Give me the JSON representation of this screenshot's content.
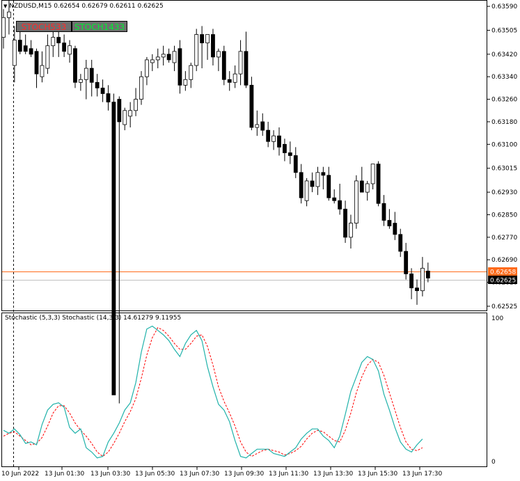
{
  "header": {
    "arrow": "▼",
    "symbol_info": "NZDUSD,M15  0.62654 0.62679 0.62611 0.62625"
  },
  "buttons": [
    {
      "label": "STOCH533",
      "color": "#ff2b2b"
    },
    {
      "label": "STOCH1433",
      "color": "#00ee33"
    }
  ],
  "indicator": {
    "title": "Stochastic (5,3,3)  Stochastic (14,3,3) 14.61279 9.11955",
    "scale_max": "100",
    "scale_min": "0"
  },
  "price_axis": {
    "labels": [
      "0.63590",
      "0.63505",
      "0.63420",
      "0.63340",
      "0.63260",
      "0.63180",
      "0.63100",
      "0.63015",
      "0.62930",
      "0.62850",
      "0.62770",
      "0.62690",
      "0.62610",
      "0.62525"
    ],
    "current_price": {
      "label": "0.62658",
      "color": "#ff6a1a"
    },
    "bid_price": {
      "label": "0.62625",
      "color": "#000000"
    }
  },
  "time_axis": {
    "labels": [
      "10 Jun 2022",
      "13 Jun 01:30",
      "13 Jun 03:30",
      "13 Jun 05:30",
      "13 Jun 07:30",
      "13 Jun 09:30",
      "13 Jun 11:30",
      "13 Jun 13:30",
      "13 Jun 15:30",
      "13 Jun 17:30"
    ]
  },
  "colors": {
    "bull_candle": "#ffffff",
    "bear_candle": "#000000",
    "stoch_main": "#20b2aa",
    "stoch_signal": "#ff0000",
    "price_line_ask": "#ff6a1a",
    "price_line_bid": "#c0c0c0"
  },
  "chart_data": {
    "type": "candlestick",
    "price_ylim": [
      0.6251,
      0.6361
    ],
    "candles": [
      {
        "o": 0.6348,
        "h": 0.6358,
        "l": 0.6344,
        "c": 0.6355
      },
      {
        "o": 0.6355,
        "h": 0.6361,
        "l": 0.6349,
        "c": 0.6357
      },
      {
        "o": 0.6338,
        "h": 0.6352,
        "l": 0.6332,
        "c": 0.6347
      },
      {
        "o": 0.6347,
        "h": 0.6351,
        "l": 0.6342,
        "c": 0.6343
      },
      {
        "o": 0.6345,
        "h": 0.6349,
        "l": 0.6342,
        "c": 0.6343
      },
      {
        "o": 0.6344,
        "h": 0.6347,
        "l": 0.6341,
        "c": 0.6342
      },
      {
        "o": 0.6343,
        "h": 0.6344,
        "l": 0.633,
        "c": 0.6335
      },
      {
        "o": 0.6334,
        "h": 0.6343,
        "l": 0.6332,
        "c": 0.6338
      },
      {
        "o": 0.6337,
        "h": 0.6349,
        "l": 0.6335,
        "c": 0.6345
      },
      {
        "o": 0.6345,
        "h": 0.6351,
        "l": 0.6341,
        "c": 0.6348
      },
      {
        "o": 0.6348,
        "h": 0.6351,
        "l": 0.6341,
        "c": 0.6346
      },
      {
        "o": 0.6346,
        "h": 0.6349,
        "l": 0.6341,
        "c": 0.6343
      },
      {
        "o": 0.6342,
        "h": 0.6347,
        "l": 0.6339,
        "c": 0.6345
      },
      {
        "o": 0.6344,
        "h": 0.6345,
        "l": 0.633,
        "c": 0.6332
      },
      {
        "o": 0.6332,
        "h": 0.6335,
        "l": 0.6329,
        "c": 0.6333
      },
      {
        "o": 0.6333,
        "h": 0.634,
        "l": 0.6326,
        "c": 0.6337
      },
      {
        "o": 0.6337,
        "h": 0.634,
        "l": 0.6327,
        "c": 0.6332
      },
      {
        "o": 0.6332,
        "h": 0.6335,
        "l": 0.6327,
        "c": 0.633
      },
      {
        "o": 0.633,
        "h": 0.6333,
        "l": 0.6325,
        "c": 0.6328
      },
      {
        "o": 0.6328,
        "h": 0.6331,
        "l": 0.6322,
        "c": 0.6325
      },
      {
        "o": 0.6325,
        "h": 0.6328,
        "l": 0.6221,
        "c": 0.6221
      },
      {
        "o": 0.6326,
        "h": 0.6327,
        "l": 0.6218,
        "c": 0.6318
      },
      {
        "o": 0.6317,
        "h": 0.6323,
        "l": 0.6315,
        "c": 0.6322
      },
      {
        "o": 0.632,
        "h": 0.6325,
        "l": 0.6316,
        "c": 0.6322
      },
      {
        "o": 0.6322,
        "h": 0.633,
        "l": 0.632,
        "c": 0.6326
      },
      {
        "o": 0.6326,
        "h": 0.6336,
        "l": 0.6324,
        "c": 0.6334
      },
      {
        "o": 0.6334,
        "h": 0.6341,
        "l": 0.6331,
        "c": 0.634
      },
      {
        "o": 0.6339,
        "h": 0.6342,
        "l": 0.6336,
        "c": 0.634
      },
      {
        "o": 0.634,
        "h": 0.6344,
        "l": 0.6337,
        "c": 0.6341
      },
      {
        "o": 0.6341,
        "h": 0.6345,
        "l": 0.6338,
        "c": 0.6342
      },
      {
        "o": 0.6342,
        "h": 0.6344,
        "l": 0.6339,
        "c": 0.634
      },
      {
        "o": 0.6339,
        "h": 0.6345,
        "l": 0.6336,
        "c": 0.6343
      },
      {
        "o": 0.6344,
        "h": 0.6347,
        "l": 0.6328,
        "c": 0.6331
      },
      {
        "o": 0.6331,
        "h": 0.6336,
        "l": 0.6329,
        "c": 0.6333
      },
      {
        "o": 0.6333,
        "h": 0.6339,
        "l": 0.633,
        "c": 0.6338
      },
      {
        "o": 0.6338,
        "h": 0.6351,
        "l": 0.6336,
        "c": 0.6349
      },
      {
        "o": 0.6349,
        "h": 0.6352,
        "l": 0.6337,
        "c": 0.6346
      },
      {
        "o": 0.6346,
        "h": 0.6349,
        "l": 0.634,
        "c": 0.6349
      },
      {
        "o": 0.6349,
        "h": 0.6351,
        "l": 0.6338,
        "c": 0.6341
      },
      {
        "o": 0.6341,
        "h": 0.6344,
        "l": 0.6336,
        "c": 0.6343
      },
      {
        "o": 0.6343,
        "h": 0.6345,
        "l": 0.6331,
        "c": 0.6333
      },
      {
        "o": 0.6333,
        "h": 0.6336,
        "l": 0.6329,
        "c": 0.6332
      },
      {
        "o": 0.6332,
        "h": 0.6338,
        "l": 0.633,
        "c": 0.6335
      },
      {
        "o": 0.6335,
        "h": 0.6347,
        "l": 0.6331,
        "c": 0.6343
      },
      {
        "o": 0.6343,
        "h": 0.635,
        "l": 0.633,
        "c": 0.6331
      },
      {
        "o": 0.6331,
        "h": 0.6334,
        "l": 0.6315,
        "c": 0.6316
      },
      {
        "o": 0.6316,
        "h": 0.6322,
        "l": 0.6313,
        "c": 0.6317
      },
      {
        "o": 0.6318,
        "h": 0.6321,
        "l": 0.6313,
        "c": 0.6315
      },
      {
        "o": 0.6315,
        "h": 0.6318,
        "l": 0.6309,
        "c": 0.6311
      },
      {
        "o": 0.6311,
        "h": 0.6315,
        "l": 0.6308,
        "c": 0.6313
      },
      {
        "o": 0.6313,
        "h": 0.6316,
        "l": 0.6306,
        "c": 0.6309
      },
      {
        "o": 0.631,
        "h": 0.6312,
        "l": 0.6304,
        "c": 0.6307
      },
      {
        "o": 0.6307,
        "h": 0.6311,
        "l": 0.6303,
        "c": 0.6306
      },
      {
        "o": 0.6306,
        "h": 0.6309,
        "l": 0.6298,
        "c": 0.63
      },
      {
        "o": 0.63,
        "h": 0.6303,
        "l": 0.6289,
        "c": 0.6291
      },
      {
        "o": 0.629,
        "h": 0.6298,
        "l": 0.6288,
        "c": 0.6297
      },
      {
        "o": 0.6297,
        "h": 0.63,
        "l": 0.6293,
        "c": 0.6295
      },
      {
        "o": 0.6295,
        "h": 0.6302,
        "l": 0.6292,
        "c": 0.63
      },
      {
        "o": 0.63,
        "h": 0.6302,
        "l": 0.6294,
        "c": 0.6299
      },
      {
        "o": 0.6299,
        "h": 0.6302,
        "l": 0.629,
        "c": 0.6291
      },
      {
        "o": 0.6291,
        "h": 0.6294,
        "l": 0.6289,
        "c": 0.629
      },
      {
        "o": 0.629,
        "h": 0.6296,
        "l": 0.6285,
        "c": 0.6287
      },
      {
        "o": 0.6287,
        "h": 0.629,
        "l": 0.6275,
        "c": 0.6277
      },
      {
        "o": 0.6277,
        "h": 0.6285,
        "l": 0.6273,
        "c": 0.6282
      },
      {
        "o": 0.6282,
        "h": 0.6299,
        "l": 0.628,
        "c": 0.6297
      },
      {
        "o": 0.6297,
        "h": 0.6302,
        "l": 0.6293,
        "c": 0.6293
      },
      {
        "o": 0.6293,
        "h": 0.6297,
        "l": 0.629,
        "c": 0.6296
      },
      {
        "o": 0.6296,
        "h": 0.6303,
        "l": 0.6294,
        "c": 0.6303
      },
      {
        "o": 0.6303,
        "h": 0.6304,
        "l": 0.6288,
        "c": 0.6289
      },
      {
        "o": 0.6289,
        "h": 0.6292,
        "l": 0.6281,
        "c": 0.6283
      },
      {
        "o": 0.6283,
        "h": 0.6287,
        "l": 0.628,
        "c": 0.6281
      },
      {
        "o": 0.6282,
        "h": 0.6286,
        "l": 0.6276,
        "c": 0.6278
      },
      {
        "o": 0.6278,
        "h": 0.628,
        "l": 0.627,
        "c": 0.6272
      },
      {
        "o": 0.6272,
        "h": 0.6275,
        "l": 0.6262,
        "c": 0.6264
      },
      {
        "o": 0.6264,
        "h": 0.6266,
        "l": 0.6255,
        "c": 0.6259
      },
      {
        "o": 0.6259,
        "h": 0.6262,
        "l": 0.6253,
        "c": 0.6258
      },
      {
        "o": 0.6258,
        "h": 0.627,
        "l": 0.6256,
        "c": 0.6266
      },
      {
        "o": 0.6265,
        "h": 0.6268,
        "l": 0.6261,
        "c": 0.62625
      }
    ],
    "stoch_main": [
      22,
      20,
      23,
      19,
      13,
      14,
      12,
      26,
      36,
      40,
      41,
      38,
      24,
      20,
      23,
      10,
      7,
      3,
      4,
      14,
      20,
      27,
      36,
      41,
      55,
      76,
      92,
      94,
      91,
      88,
      84,
      78,
      73,
      82,
      88,
      91,
      84,
      66,
      52,
      40,
      36,
      28,
      15,
      4,
      3,
      6,
      9,
      9,
      9,
      6,
      5,
      4,
      7,
      10,
      16,
      20,
      23,
      23,
      18,
      15,
      10,
      18,
      33,
      49,
      59,
      69,
      73,
      71,
      63,
      47,
      36,
      24,
      14,
      9,
      7,
      12,
      16
    ],
    "stoch_signal": [
      18,
      20,
      21,
      18,
      15,
      12,
      13,
      17,
      25,
      34,
      39,
      39,
      34,
      27,
      22,
      18,
      13,
      7,
      4,
      7,
      13,
      20,
      28,
      35,
      44,
      58,
      74,
      86,
      93,
      91,
      87,
      82,
      78,
      78,
      82,
      87,
      88,
      80,
      67,
      52,
      42,
      34,
      25,
      14,
      7,
      4,
      6,
      8,
      9,
      8,
      7,
      5,
      6,
      8,
      11,
      16,
      20,
      22,
      21,
      18,
      15,
      14,
      22,
      34,
      48,
      59,
      67,
      71,
      69,
      60,
      48,
      36,
      24,
      14,
      9,
      8,
      10
    ],
    "stoch_ylim": [
      0,
      100
    ]
  }
}
